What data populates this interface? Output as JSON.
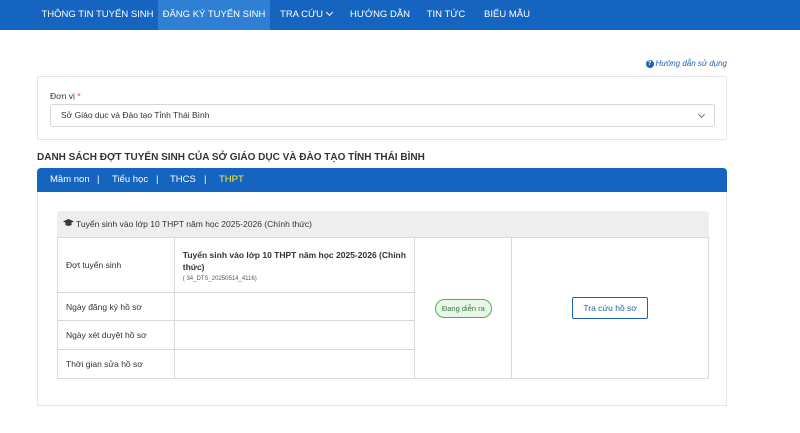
{
  "nav": {
    "items": [
      {
        "label": "THÔNG TIN TUYỂN SINH"
      },
      {
        "label": "ĐĂNG KÝ TUYỂN SINH"
      },
      {
        "label": "TRA CỨU"
      },
      {
        "label": "HƯỚNG DẪN"
      },
      {
        "label": "TIN TỨC"
      },
      {
        "label": "BIỂU MẪU"
      }
    ],
    "active_index": 1
  },
  "help_link": "Hướng dẫn sử dụng",
  "unit": {
    "label": "Đơn vị",
    "required_mark": "*",
    "selected": "Sở Giáo dục và Đào tạo Tỉnh Thái Bình"
  },
  "section_title": "DANH SÁCH ĐỢT TUYỂN SINH CỦA SỞ GIÁO DỤC VÀ ĐÀO TẠO TỈNH THÁI BÌNH",
  "level_tabs": {
    "items": [
      "Mầm non",
      "Tiểu học",
      "THCS",
      "THPT"
    ],
    "separator": "|",
    "active_index": 3
  },
  "round_card": {
    "header": "Tuyển sinh vào lớp 10 THPT năm học 2025-2026 (Chính thức)",
    "rows": [
      {
        "label": "Đợt tuyển sinh",
        "value_title": "Tuyển sinh vào lớp 10 THPT năm học 2025-2026 (Chính thức)",
        "value_code": "( 34_DTS_20250514_4116)"
      },
      {
        "label": "Ngày đăng ký hồ sơ",
        "value": ""
      },
      {
        "label": "Ngày xét duyệt hồ sơ",
        "value": ""
      },
      {
        "label": "Thời gian sửa hồ sơ",
        "value": ""
      }
    ],
    "status": "Đang diễn ra",
    "action_label": "Tra cứu hồ sơ"
  },
  "colors": {
    "primary": "#1565c0",
    "active_tab_text": "#ffeb3b",
    "status_green": "#4caf50"
  }
}
